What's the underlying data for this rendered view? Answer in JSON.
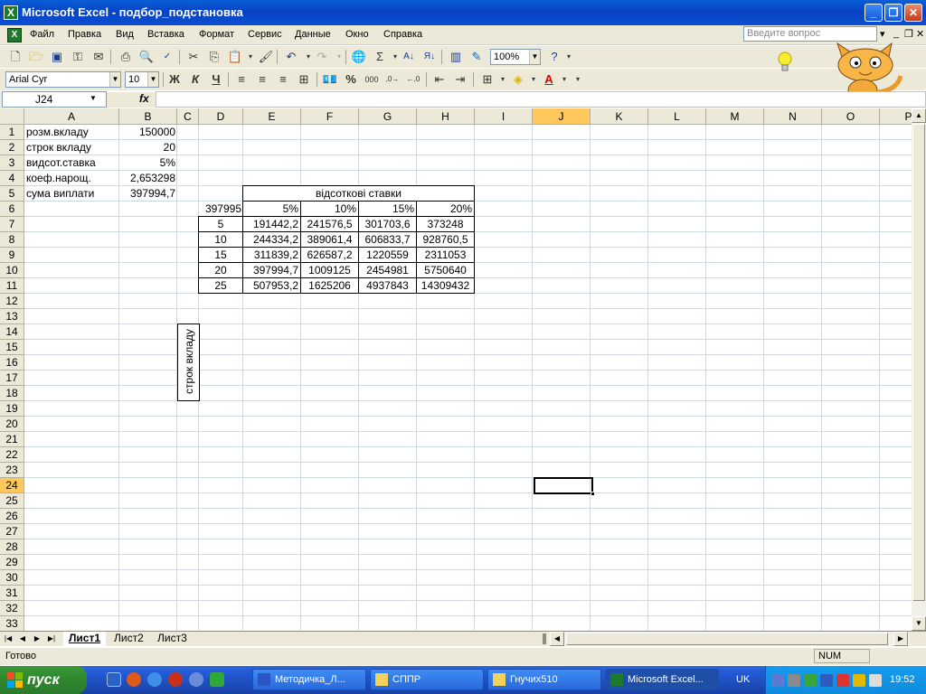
{
  "window": {
    "title": "Microsoft Excel - подбор_подстановка"
  },
  "menu": [
    "Файл",
    "Правка",
    "Вид",
    "Вставка",
    "Формат",
    "Сервис",
    "Данные",
    "Окно",
    "Справка"
  ],
  "ask_placeholder": "Введите вопрос",
  "toolbar": {
    "zoom": "100%",
    "font_name": "Arial Cyr",
    "font_size": "10",
    "bold": "Ж",
    "italic": "К",
    "underline": "Ч"
  },
  "formula_bar": {
    "name_box": "J24",
    "fx": "fx",
    "value": ""
  },
  "columns": [
    "A",
    "B",
    "C",
    "D",
    "E",
    "F",
    "G",
    "H",
    "I",
    "J",
    "K",
    "L",
    "M",
    "N",
    "O",
    "P"
  ],
  "rows": [
    "1",
    "2",
    "3",
    "4",
    "5",
    "6",
    "7",
    "8",
    "9",
    "10",
    "11",
    "12",
    "13",
    "14",
    "15",
    "16",
    "17",
    "18",
    "19",
    "20",
    "21",
    "22",
    "23",
    "24",
    "25",
    "26",
    "27",
    "28",
    "29",
    "30",
    "31",
    "32",
    "33"
  ],
  "cells": {
    "A1": "розм.вкладу",
    "B1": "150000",
    "A2": "строк вкладу",
    "B2": "20",
    "A3": "видсот.ставка",
    "B3": "5%",
    "A4": "коеф.нарощ.",
    "B4": "2,653298",
    "A5": "сума виплати",
    "B5": "397994,7",
    "E5": "відсоткові ставки",
    "D6": "397995",
    "E6": "5%",
    "F6": "10%",
    "G6": "15%",
    "H6": "20%",
    "C7": "строк вкладу",
    "D7": "5",
    "E7": "191442,2",
    "F7": "241576,5",
    "G7": "301703,6",
    "H7": "373248",
    "D8": "10",
    "E8": "244334,2",
    "F8": "389061,4",
    "G8": "606833,7",
    "H8": "928760,5",
    "D9": "15",
    "E9": "311839,2",
    "F9": "626587,2",
    "G9": "1220559",
    "H9": "2311053",
    "D10": "20",
    "E10": "397994,7",
    "F10": "1009125",
    "G10": "2454981",
    "H10": "5750640",
    "D11": "25",
    "E11": "507953,2",
    "F11": "1625206",
    "G11": "4937843",
    "H11": "14309432"
  },
  "sheets": [
    "Лист1",
    "Лист2",
    "Лист3"
  ],
  "active_sheet": "Лист1",
  "status": {
    "ready": "Готово",
    "num": "NUM"
  },
  "taskbar": {
    "start": "пуск",
    "buttons": [
      "Методичка_Л...",
      "СППР",
      "Гнучих510",
      "Microsoft Excel..."
    ],
    "lang": "UK",
    "clock": "19:52"
  }
}
